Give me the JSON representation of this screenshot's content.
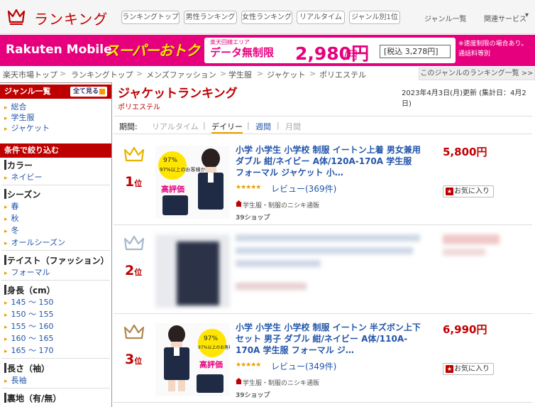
{
  "header": {
    "title": "ランキング",
    "nav": [
      "ランキングトップ",
      "男性ランキング",
      "女性ランキング",
      "リアルタイム",
      "ジャンル別1位"
    ],
    "links": [
      "ジャンル一覧",
      "関連サービス"
    ],
    "accent": "#bf0000"
  },
  "banner": {
    "logo": "Rakuten Mobile",
    "headline": "スーパーおトク",
    "area": "楽天回線エリア",
    "data": "データ無制限",
    "price": "2,980円",
    "unit": "/月",
    "tax": "[税込 3,278円]",
    "note1": "※速度制限の場合あり。",
    "note2": "通話料等別",
    "color": "#e6007e"
  },
  "breadcrumb": {
    "items": [
      "楽天市場トップ",
      "ランキングトップ",
      "メンズファッション",
      "学生服",
      "ジャケット",
      "ポリエステル"
    ],
    "genre_link": "このジャンルのランキング一覧 >>"
  },
  "sidebar": {
    "genre_header": "ジャンル一覧",
    "show_all": "全て見る",
    "genres": [
      "総合",
      "学生服",
      "ジャケット"
    ],
    "filter_header": "条件で絞り込む",
    "groups": [
      {
        "title": "カラー",
        "items": [
          "ネイビー"
        ]
      },
      {
        "title": "シーズン",
        "items": [
          "春",
          "秋",
          "冬",
          "オールシーズン"
        ]
      },
      {
        "title": "テイスト（ファッション）",
        "items": [
          "フォーマル"
        ]
      },
      {
        "title": "身長（cm）",
        "items": [
          "145 ～ 150",
          "150 ～ 155",
          "155 ～ 160",
          "160 ～ 165",
          "165 ～ 170"
        ]
      },
      {
        "title": "長さ（袖）",
        "items": [
          "長袖"
        ]
      },
      {
        "title": "裏地（有/無）",
        "items": []
      }
    ]
  },
  "main": {
    "title": "ジャケットランキング",
    "subtitle": "ポリエステル",
    "updated": "2023年4月3日(月)更新 (集計日：4月2日)",
    "period_label": "期間:",
    "periods": [
      "リアルタイム",
      "デイリー",
      "週間",
      "月間"
    ],
    "selected_period": "デイリー"
  },
  "items": [
    {
      "rank": "1",
      "rank_suffix": "位",
      "title": "小学 小学生 小学校 制服 イートン上着 男女兼用 ダブル 紺/ネイビー A体/120A-170A 学生服 フォーマル ジャケット 小…",
      "stars": "★★★★★",
      "review": "レビュー(369件)",
      "shop": "学生服・制服のニシキ通販",
      "shop_tag": "39ショップ",
      "price": "5,800円",
      "fav": "お気に入り",
      "crown_color": "#e8b400",
      "img_badge": "97%以上のお客様から",
      "img_badge2": "高評価"
    },
    {
      "rank": "2",
      "rank_suffix": "位",
      "crown_color": "#a8b8c8"
    },
    {
      "rank": "3",
      "rank_suffix": "位",
      "title": "小学 小学生 小学校 制服 イートン 半ズボン上下セット 男子 ダブル 紺/ネイビー A体/110A-170A 学生服 フォーマル ジ…",
      "stars": "★★★★★",
      "review": "レビュー(349件)",
      "shop": "学生服・制服のニシキ通販",
      "shop_tag": "39ショップ",
      "price": "6,990円",
      "fav": "お気に入り",
      "crown_color": "#b08850",
      "img_badge": "97%以上のお客様から",
      "img_badge2": "高評価"
    }
  ]
}
